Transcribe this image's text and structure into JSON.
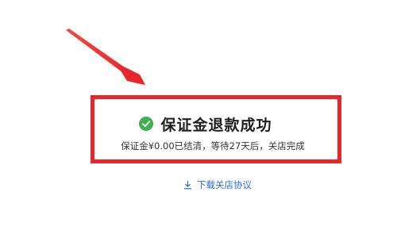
{
  "result": {
    "title": "保证金退款成功",
    "description": "保证金¥0.00已结清，等待27天后，关店完成",
    "status_color": "#3fb150",
    "icon": "check-circle-icon"
  },
  "download": {
    "label": "下载关店协议",
    "icon": "download-icon",
    "color": "#2b6de0"
  },
  "annotation": {
    "color": "#e8262c"
  }
}
